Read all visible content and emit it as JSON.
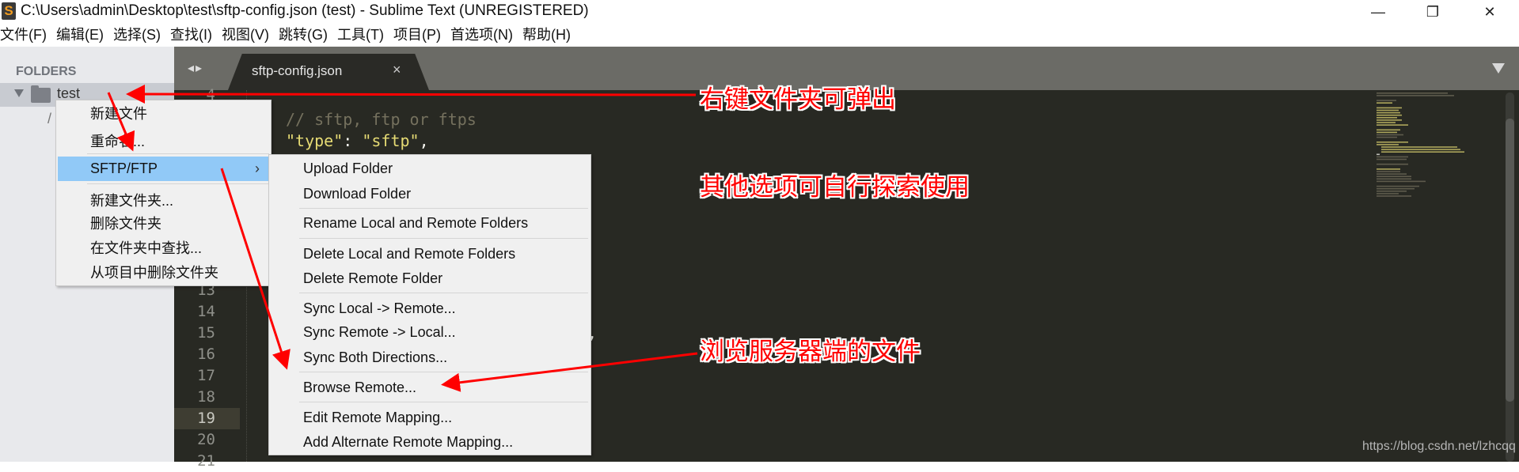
{
  "window": {
    "title": "C:\\Users\\admin\\Desktop\\test\\sftp-config.json (test) - Sublime Text (UNREGISTERED)",
    "app_icon": "S",
    "controls": {
      "minimize": "—",
      "restore": "❐",
      "close": "✕"
    }
  },
  "menubar": [
    "文件(F)",
    "编辑(E)",
    "选择(S)",
    "查找(I)",
    "视图(V)",
    "跳转(G)",
    "工具(T)",
    "项目(P)",
    "首选项(N)",
    "帮助(H)"
  ],
  "sidebar": {
    "title": "FOLDERS",
    "folder": "test",
    "file_fragment": "/"
  },
  "tabs": {
    "nav": "◂▸",
    "active": "sftp-config.json",
    "close": "×"
  },
  "editor": {
    "line_numbers": [
      "4",
      "13",
      "14",
      "15",
      "16",
      "17",
      "18",
      "19",
      "20",
      "21"
    ],
    "highlighted_line": "19",
    "code": {
      "comment": "// sftp, ftp or ftps",
      "type_key": "\"type\"",
      "type_colon": ": ",
      "type_value": "\"sftp\"",
      "type_comma": ",",
      "line15_fragment_value": "e",
      "line15_fragment_comma": ","
    },
    "colors": {
      "background": "#282923",
      "string": "#e6db74",
      "comment": "#75715e",
      "constant": "#ae81ff"
    }
  },
  "context_menu": {
    "items": [
      "新建文件",
      "重命名...",
      "SFTP/FTP",
      "新建文件夹...",
      "删除文件夹",
      "在文件夹中查找...",
      "从项目中删除文件夹"
    ],
    "submenu_arrow": "›",
    "highlight_color": "#91c9f7"
  },
  "sftp_submenu": {
    "items": [
      "Upload Folder",
      "Download Folder",
      "Rename Local and Remote Folders",
      "Delete Local and Remote Folders",
      "Delete Remote Folder",
      "Sync Local -> Remote...",
      "Sync Remote -> Local...",
      "Sync Both Directions...",
      "Browse Remote...",
      "Edit Remote Mapping...",
      "Add Alternate Remote Mapping..."
    ]
  },
  "annotations": {
    "a1": "右键文件夹可弹出",
    "a2": "其他选项可自行探索使用",
    "a3": "浏览服务器端的文件",
    "color": "#ff0000"
  },
  "watermark": "https://blog.csdn.net/lzhcqq"
}
